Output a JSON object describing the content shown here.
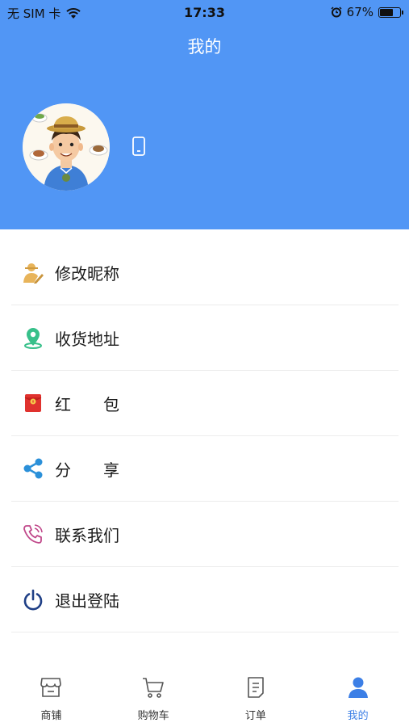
{
  "status_bar": {
    "carrier": "无 SIM 卡",
    "time": "17:33",
    "battery_percent_text": "67%",
    "battery_level": 0.67
  },
  "header": {
    "title": "我的",
    "background_color": "#5196f5",
    "avatar_icon": "avatar-illustration",
    "phone_icon": "mobile-phone-icon"
  },
  "menu": {
    "items": [
      {
        "label": "修改昵称",
        "icon": "user-edit-icon",
        "color": "#e8b45a"
      },
      {
        "label": "收货地址",
        "icon": "location-pin-icon",
        "color": "#37c08a"
      },
      {
        "label": "红　　包",
        "icon": "red-envelope-icon",
        "color": "#e0322e"
      },
      {
        "label": "分　　享",
        "icon": "share-icon",
        "color": "#2b90d9"
      },
      {
        "label": "联系我们",
        "icon": "phone-call-icon",
        "color": "#c0488a"
      },
      {
        "label": "退出登陆",
        "icon": "power-icon",
        "color": "#1f3f86"
      }
    ]
  },
  "tabbar": {
    "items": [
      {
        "label": "商铺",
        "icon": "store-icon",
        "active": false
      },
      {
        "label": "购物车",
        "icon": "cart-icon",
        "active": false
      },
      {
        "label": "订单",
        "icon": "order-icon",
        "active": false
      },
      {
        "label": "我的",
        "icon": "user-icon",
        "active": true
      }
    ],
    "active_color": "#3c7fe6"
  }
}
